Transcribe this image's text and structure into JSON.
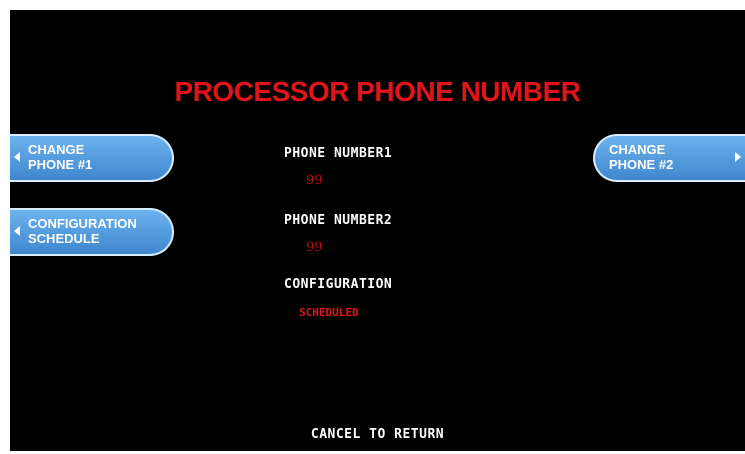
{
  "screen": {
    "title": "PROCESSOR PHONE NUMBER"
  },
  "buttons": {
    "change_phone_1": [
      "CHANGE",
      "PHONE #1"
    ],
    "configuration_schedule": [
      "CONFIGURATION",
      "SCHEDULE"
    ],
    "change_phone_2": [
      "CHANGE",
      "PHONE #2"
    ]
  },
  "fields": {
    "phone_number1": {
      "label": "PHONE NUMBER1",
      "value": "99"
    },
    "phone_number2": {
      "label": "PHONE NUMBER2",
      "value": "99"
    },
    "configuration": {
      "label": "CONFIGURATION",
      "value": "SCHEDULED"
    }
  },
  "footer": {
    "cancel_label": "CANCEL TO RETURN"
  },
  "colors": {
    "background": "#000000",
    "title": "#e0141a",
    "button": "#4f97dc",
    "value": "#c01010"
  }
}
